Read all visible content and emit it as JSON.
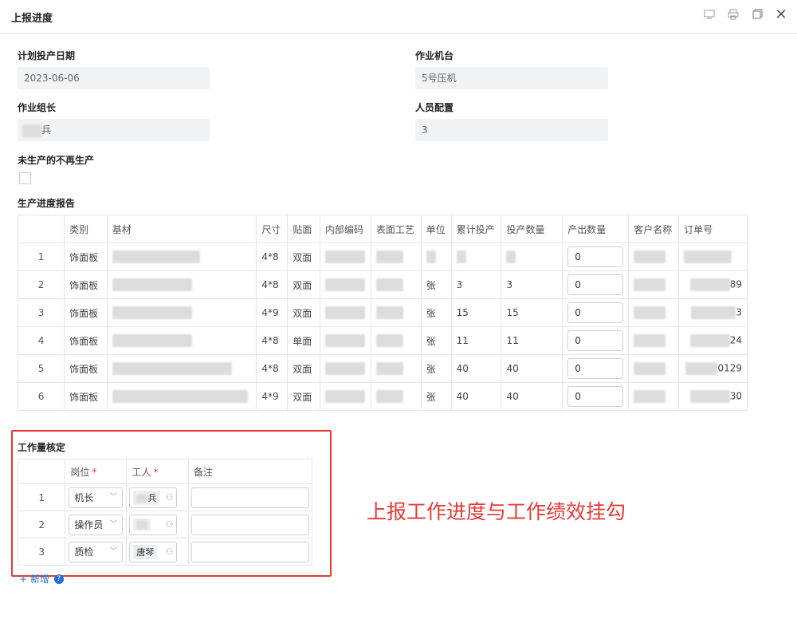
{
  "dialog": {
    "title": "上报进度"
  },
  "form": {
    "plan_date_label": "计划投产日期",
    "plan_date_value": "2023-06-06",
    "machine_label": "作业机台",
    "machine_value": "5号压机",
    "leader_label": "作业组长",
    "leader_value": "兵",
    "staff_label": "人员配置",
    "staff_value": "3",
    "no_more_label": "未生产的不再生产"
  },
  "progress": {
    "title": "生产进度报告",
    "columns": [
      "类别",
      "基材",
      "尺寸",
      "贴面",
      "内部编码",
      "表面工艺",
      "单位",
      "累计投产",
      "投产数量",
      "产出数量",
      "客户名称",
      "订单号"
    ],
    "rows": [
      {
        "no": "1",
        "category": "饰面板",
        "size": "4*8",
        "face": "双面",
        "unit": "",
        "total": "",
        "qty": "",
        "output": "0",
        "order": ""
      },
      {
        "no": "2",
        "category": "饰面板",
        "size": "4*8",
        "face": "双面",
        "unit": "张",
        "total": "3",
        "qty": "3",
        "output": "0",
        "order": "89"
      },
      {
        "no": "3",
        "category": "饰面板",
        "size": "4*9",
        "face": "双面",
        "unit": "张",
        "total": "15",
        "qty": "15",
        "output": "0",
        "order": "3"
      },
      {
        "no": "4",
        "category": "饰面板",
        "size": "4*8",
        "face": "单面",
        "unit": "张",
        "total": "11",
        "qty": "11",
        "output": "0",
        "order": "24"
      },
      {
        "no": "5",
        "category": "饰面板",
        "size": "4*8",
        "face": "双面",
        "unit": "张",
        "total": "40",
        "qty": "40",
        "output": "0",
        "order": "0129"
      },
      {
        "no": "6",
        "category": "饰面板",
        "size": "4*9",
        "face": "双面",
        "unit": "张",
        "total": "40",
        "qty": "40",
        "output": "0",
        "order": "30"
      }
    ]
  },
  "workload": {
    "title": "工作量核定",
    "col_post": "岗位",
    "col_worker": "工人",
    "col_note": "备注",
    "rows": [
      {
        "no": "1",
        "post": "机长",
        "worker": "兵"
      },
      {
        "no": "2",
        "post": "操作员",
        "worker": ""
      },
      {
        "no": "3",
        "post": "质检",
        "worker": "唐琴"
      }
    ],
    "add_label": "+ 新增"
  },
  "annotation": "上报工作进度与工作绩效挂勾",
  "colors": {
    "accent": "#1e6fd9",
    "annotation": "#e53935"
  }
}
